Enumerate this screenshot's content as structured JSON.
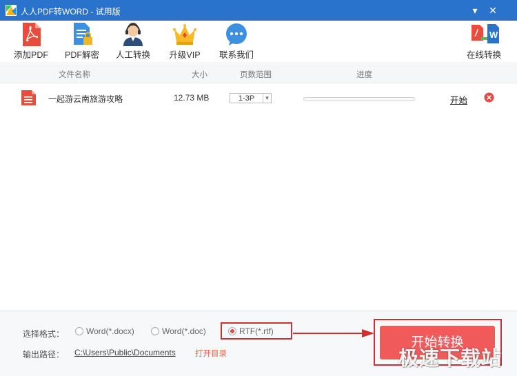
{
  "window": {
    "title": "人人PDF转WORD - 试用版",
    "min_glyph": "▾",
    "close_glyph": "✕"
  },
  "toolbar": {
    "add_pdf": "添加PDF",
    "pdf_decrypt": "PDF解密",
    "manual_convert": "人工转换",
    "upgrade_vip": "升级VIP",
    "contact_us": "联系我们",
    "online_convert": "在线转换"
  },
  "table": {
    "headers": {
      "name": "文件名称",
      "size": "大小",
      "pages": "页数范围",
      "progress": "进度"
    },
    "rows": [
      {
        "name": "一起游云南旅游攻略",
        "size": "12.73 MB",
        "pages": "1-3P",
        "progress": 0,
        "action": "开始"
      }
    ]
  },
  "bottom": {
    "format_label": "选择格式：",
    "formats": [
      {
        "label": "Word(*.docx)",
        "selected": false
      },
      {
        "label": "Word(*.doc)",
        "selected": false
      },
      {
        "label": "RTF(*.rtf)",
        "selected": true
      }
    ],
    "path_label": "输出路径：",
    "path": "C:\\Users\\Public\\Documents",
    "open_dir": "打开目录",
    "convert_button": "开始转换"
  },
  "watermark": "极速下载站",
  "colors": {
    "titlebar": "#2a73cc",
    "accent": "#f05a5a",
    "annotation": "#d12f2f"
  }
}
